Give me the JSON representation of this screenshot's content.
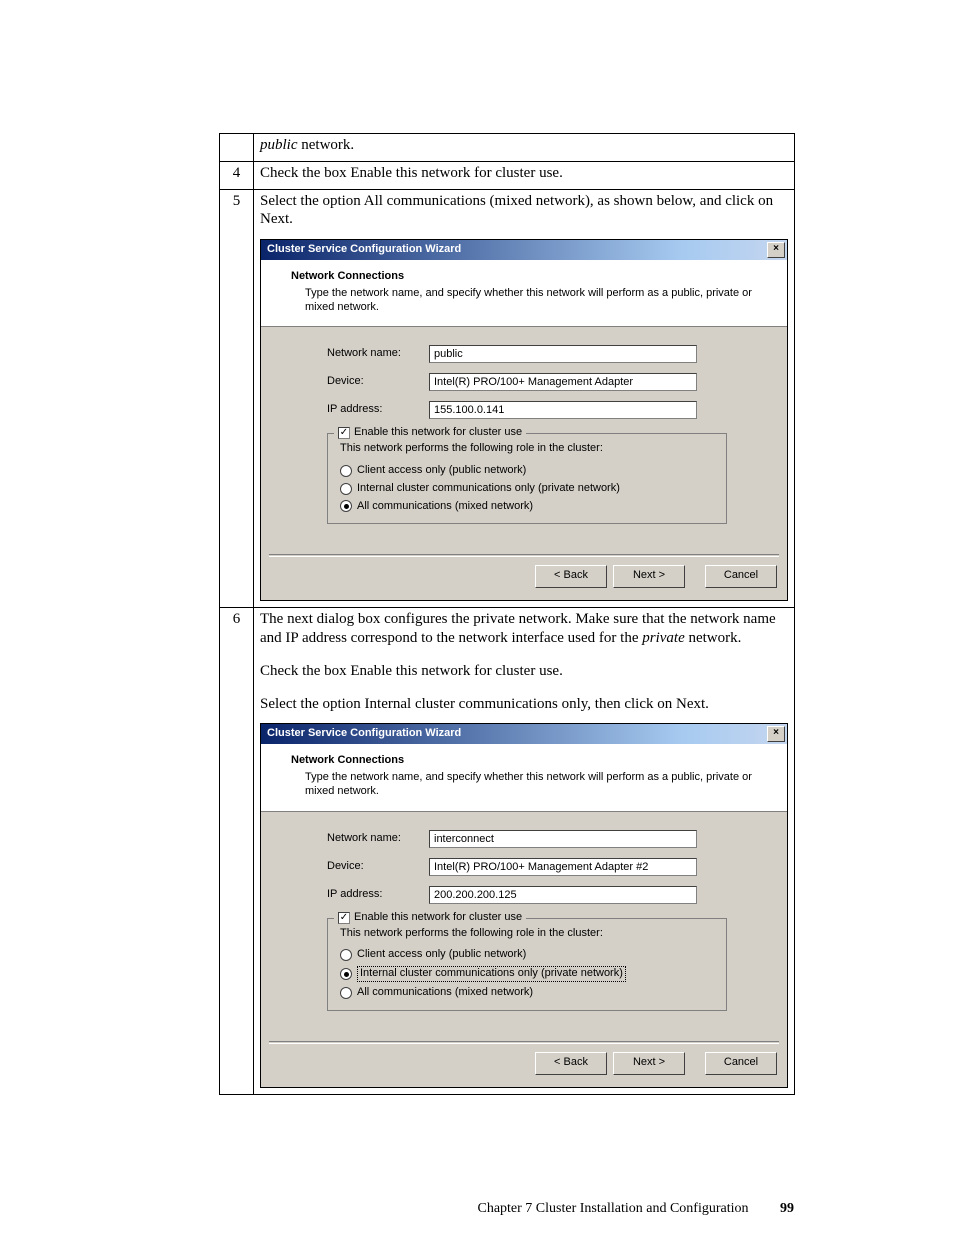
{
  "row3": {
    "text_a": "public",
    "text_b": " network."
  },
  "row4": {
    "num": "4",
    "text": "Check the box Enable this network for cluster use."
  },
  "row5": {
    "num": "5",
    "text": "Select the option All communications (mixed network), as shown below, and click on Next."
  },
  "row6": {
    "num": "6",
    "line1a": "The next dialog box configures the private network. Make sure that the network name and IP address correspond to the network interface used for the ",
    "line1_italic": "private",
    "line1b": " network.",
    "line2": "Check the box Enable this network for cluster use.",
    "line3": "Select the option Internal cluster communications only, then click on Next."
  },
  "dialog1": {
    "title": "Cluster Service Configuration Wizard",
    "header_title": "Network Connections",
    "header_sub": "Type the network name, and specify whether this network will perform as a public, private or mixed network.",
    "label_name": "Network name:",
    "value_name": "public",
    "label_device": "Device:",
    "value_device": "Intel(R) PRO/100+ Management Adapter",
    "label_ip": "IP address:",
    "value_ip": "155.100.0.141",
    "checkbox_label": "Enable this network for cluster use",
    "fs_desc": "This network performs the following role in the cluster:",
    "radio1": "Client access only (public network)",
    "radio2": "Internal cluster communications only (private network)",
    "radio3": "All communications (mixed network)",
    "btn_back": "< Back",
    "btn_next": "Next >",
    "btn_cancel": "Cancel"
  },
  "dialog2": {
    "title": "Cluster Service Configuration Wizard",
    "header_title": "Network Connections",
    "header_sub": "Type the network name, and specify whether this network will perform as a public, private or mixed network.",
    "label_name": "Network name:",
    "value_name": "interconnect",
    "label_device": "Device:",
    "value_device": "Intel(R) PRO/100+ Management Adapter #2",
    "label_ip": "IP address:",
    "value_ip": "200.200.200.125",
    "checkbox_label": "Enable this network for cluster use",
    "fs_desc": "This network performs the following role in the cluster:",
    "radio1": "Client access only (public network)",
    "radio2": "Internal cluster communications only (private network)",
    "radio3": "All communications (mixed network)",
    "btn_back": "< Back",
    "btn_next": "Next >",
    "btn_cancel": "Cancel"
  },
  "footer": {
    "text": "Chapter 7 Cluster Installation and Configuration",
    "page": "99"
  }
}
